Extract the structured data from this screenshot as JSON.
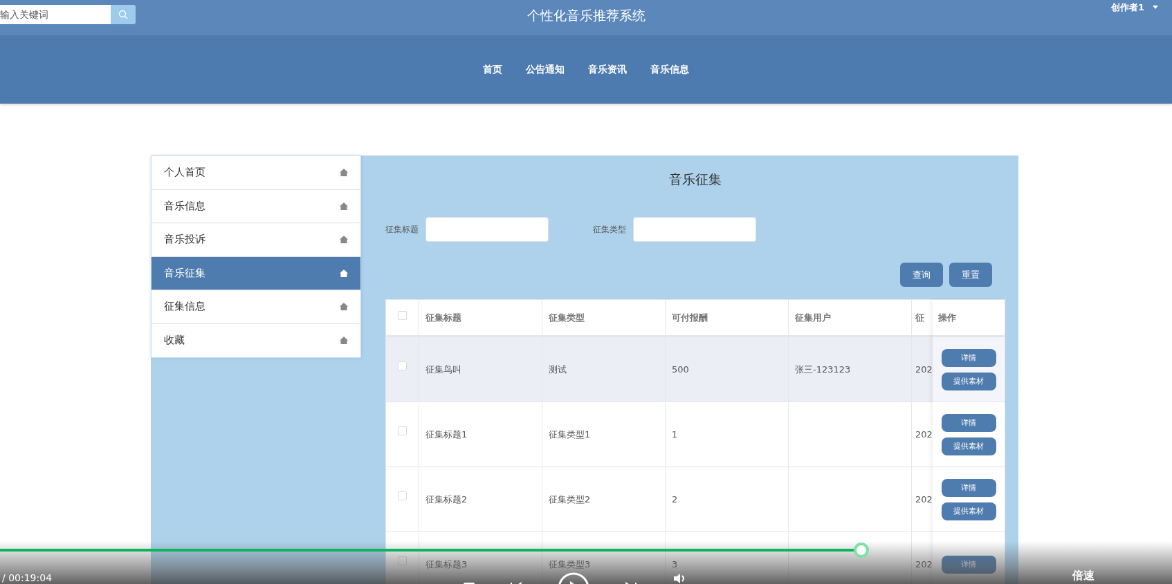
{
  "header": {
    "search": {
      "placeholder": "输入关键词"
    },
    "title": "个性化音乐推荐系统",
    "user": "创作者1"
  },
  "nav": [
    {
      "label": "首页"
    },
    {
      "label": "公告通知"
    },
    {
      "label": "音乐资讯"
    },
    {
      "label": "音乐信息"
    }
  ],
  "sidebar": {
    "items": [
      {
        "label": "个人首页",
        "selected": false
      },
      {
        "label": "音乐信息",
        "selected": false
      },
      {
        "label": "音乐投诉",
        "selected": false
      },
      {
        "label": "音乐征集",
        "selected": true
      },
      {
        "label": "征集信息",
        "selected": false
      },
      {
        "label": "收藏",
        "selected": false
      }
    ]
  },
  "content": {
    "title": "音乐征集",
    "filters": [
      {
        "label": "征集标题"
      },
      {
        "label": "征集类型"
      }
    ],
    "buttons": [
      "查询",
      "重置"
    ],
    "table": {
      "header_checked": false,
      "columns": [
        "征集标题",
        "征集类型",
        "可付报酬",
        "征集用户",
        "征"
      ],
      "action_column": "操作",
      "rows": [
        {
          "checked": false,
          "highlighted": true,
          "cells": [
            "征集鸟叫",
            "测试",
            "500",
            "张三-123123",
            "202"
          ],
          "actions": [
            "详情",
            "提供素材"
          ]
        },
        {
          "checked": false,
          "highlighted": false,
          "cells": [
            "征集标题1",
            "征集类型1",
            "1",
            "",
            "202"
          ],
          "actions": [
            "详情",
            "提供素材"
          ]
        },
        {
          "checked": false,
          "highlighted": false,
          "cells": [
            "征集标题2",
            "征集类型2",
            "2",
            "",
            "202"
          ],
          "actions": [
            "详情",
            "提供素材"
          ]
        },
        {
          "checked": false,
          "highlighted": false,
          "cells": [
            "征集标题3",
            "征集类型3",
            "3",
            "",
            "202"
          ],
          "actions": [
            "详情"
          ]
        }
      ]
    }
  },
  "player": {
    "level": 0.735,
    "time": "/ 00:19:04",
    "speed": "倍速"
  }
}
